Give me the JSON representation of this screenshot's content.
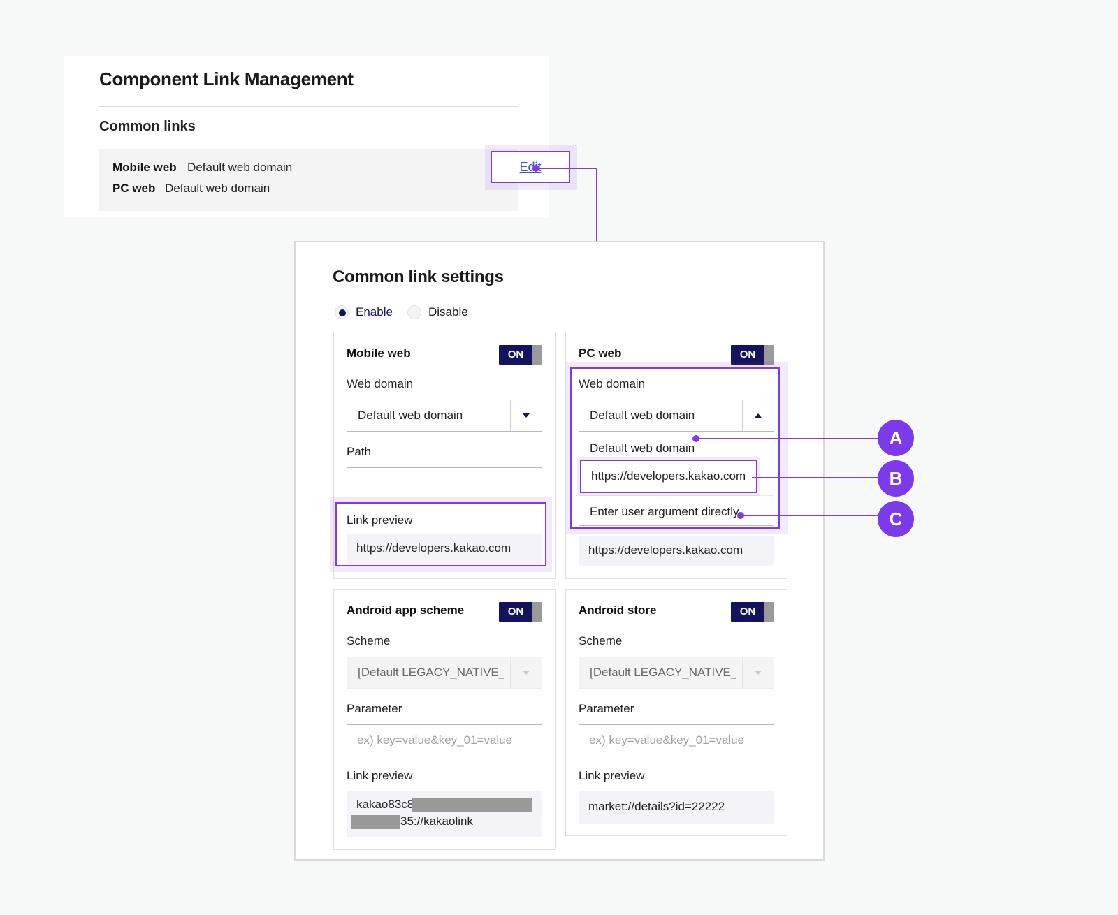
{
  "top_panel": {
    "title": "Component Link Management",
    "subtitle": "Common links",
    "rows": [
      {
        "label": "Mobile web",
        "value": "Default web domain"
      },
      {
        "label": "PC web",
        "value": "Default web domain"
      }
    ],
    "edit_label": "Edit"
  },
  "settings": {
    "title": "Common link settings",
    "radio": {
      "enable": "Enable",
      "disable": "Disable",
      "selected": "Enable"
    },
    "cards": {
      "mobile_web": {
        "title": "Mobile web",
        "toggle": "ON",
        "domain_label": "Web domain",
        "domain_value": "Default web domain",
        "path_label": "Path",
        "path_value": "",
        "preview_label": "Link preview",
        "preview_value": "https://developers.kakao.com"
      },
      "pc_web": {
        "title": "PC web",
        "toggle": "ON",
        "domain_label": "Web domain",
        "domain_value": "Default web domain",
        "dropdown_options": [
          "Default web domain",
          "https://developers.kakao.com",
          "Enter user argument directly"
        ],
        "preview_value": "https://developers.kakao.com"
      },
      "android_app_scheme": {
        "title": "Android app scheme",
        "toggle": "ON",
        "scheme_label": "Scheme",
        "scheme_value": "[Default LEGACY_NATIVE_A",
        "parameter_label": "Parameter",
        "parameter_placeholder": "ex) key=value&key_01=value",
        "preview_label": "Link preview",
        "preview_line1": "kakao83c8",
        "preview_line2": "35://kakaolink"
      },
      "android_store": {
        "title": "Android store",
        "toggle": "ON",
        "scheme_label": "Scheme",
        "scheme_value": "[Default LEGACY_NATIVE_A",
        "parameter_label": "Parameter",
        "parameter_placeholder": "ex) key=value&key_01=value",
        "preview_label": "Link preview",
        "preview_value": "market://details?id=22222"
      }
    }
  },
  "markers": [
    "A",
    "B",
    "C"
  ],
  "colors": {
    "accent": "#7c3aed",
    "toggle_on": "#14135e",
    "link": "#3b52d8"
  }
}
